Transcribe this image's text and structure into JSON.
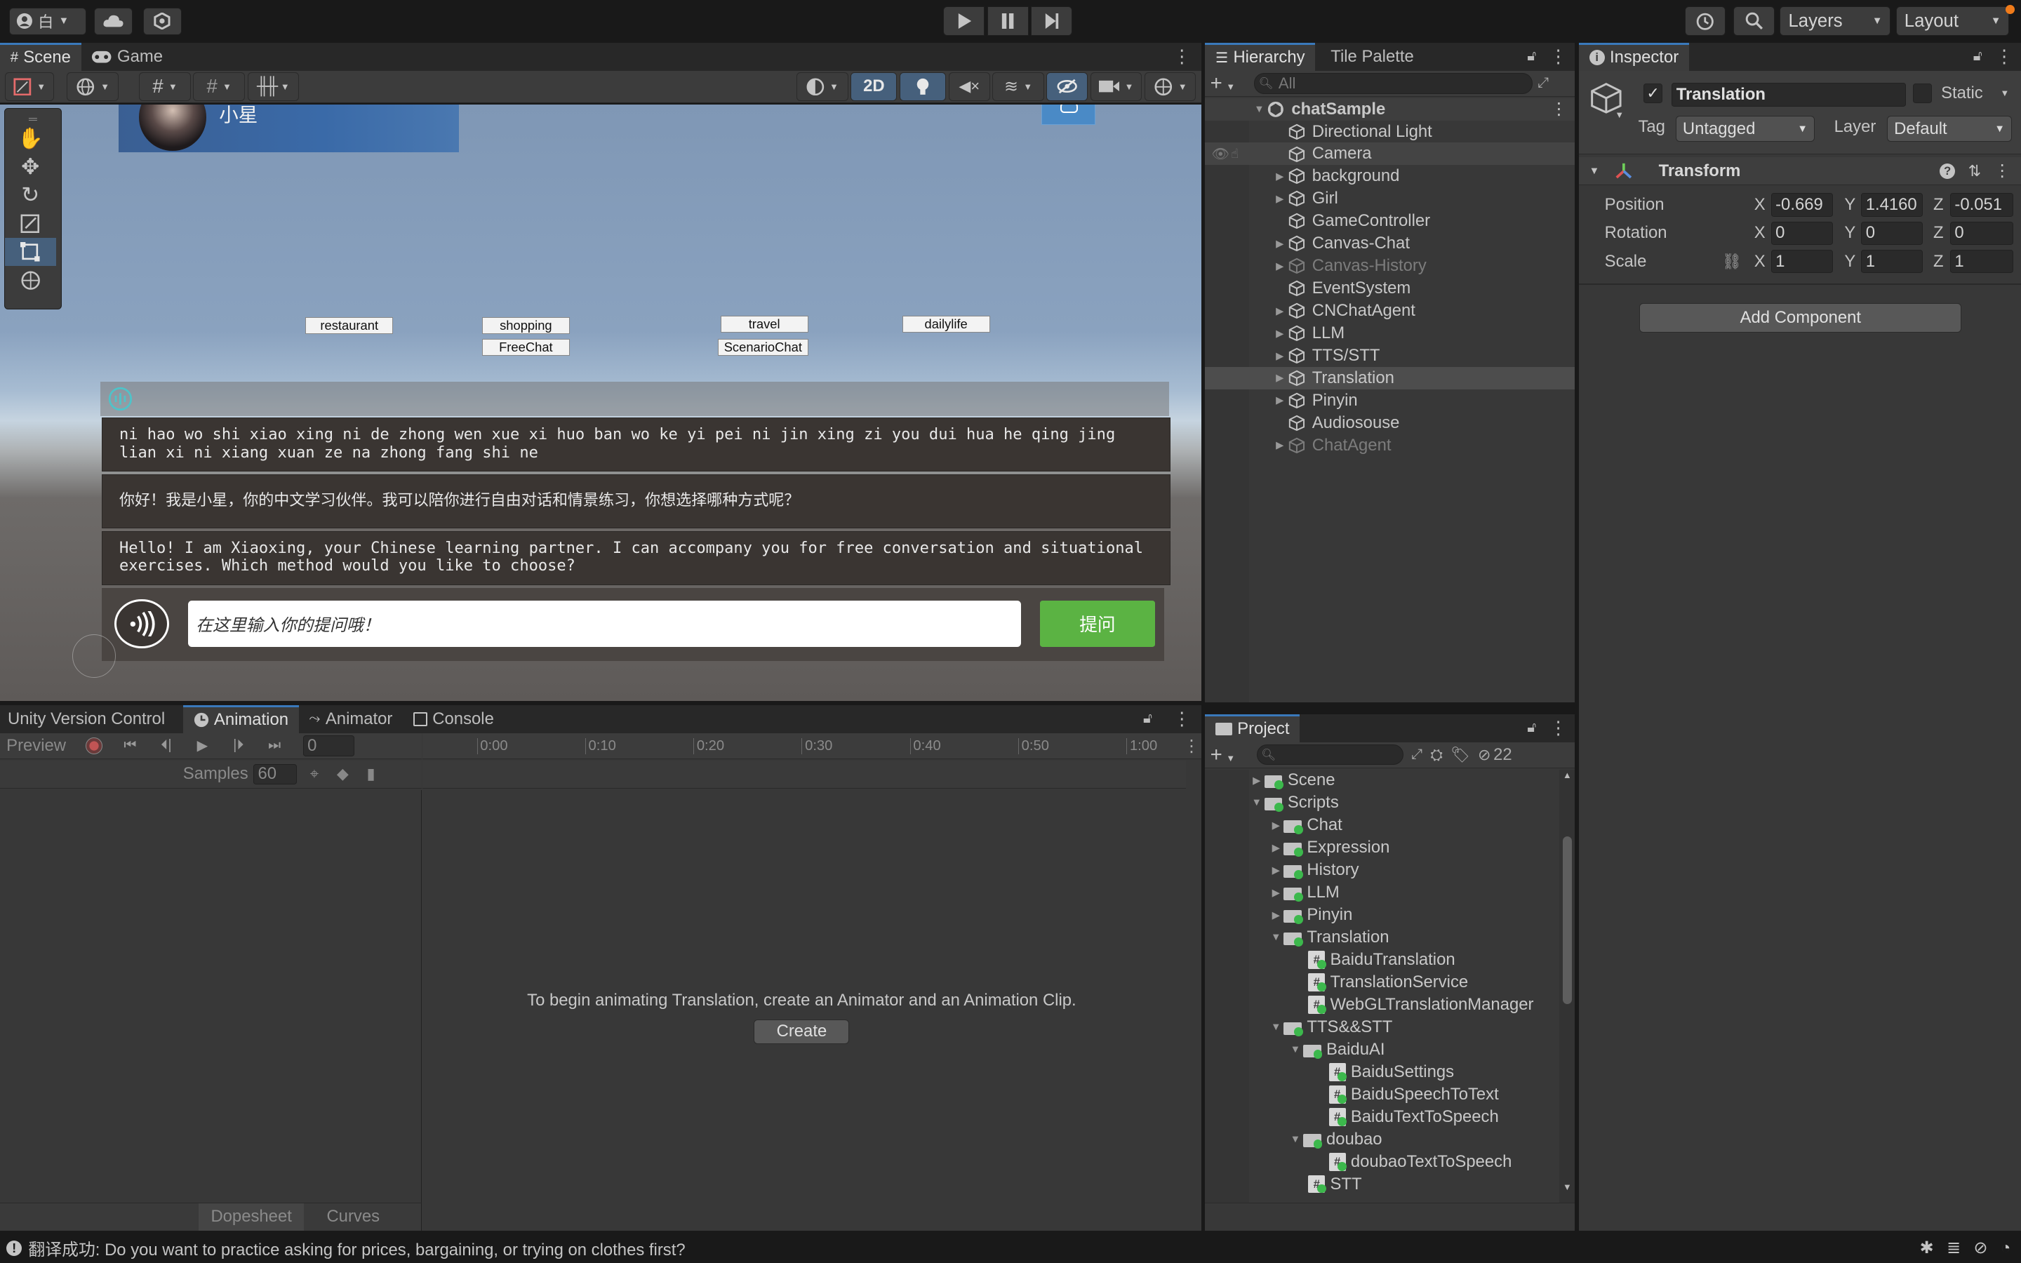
{
  "toolbar": {
    "account_label": "白",
    "layers_label": "Layers",
    "layout_label": "Layout"
  },
  "scene_tabs": {
    "scene": "Scene",
    "game": "Game"
  },
  "scene_toolbar": {
    "mode_2d": "2D"
  },
  "scene_view": {
    "character_name": "小星",
    "buttons": [
      "restaurant",
      "shopping",
      "travel",
      "dailylife",
      "FreeChat",
      "ScenarioChat"
    ],
    "pinyin_text": "ni hao wo shi xiao xing ni de zhong wen xue xi huo ban wo ke yi pei ni jin xing zi you dui hua he qing jing lian xi ni xiang xuan ze na zhong fang shi ne",
    "chinese_text": "你好！我是小星，你的中文学习伙伴。我可以陪你进行自由对话和情景练习，你想选择哪种方式呢？",
    "english_text": "Hello! I am Xiaoxing, your Chinese learning partner. I can accompany you for free conversation and situational exercises. Which method would you like to choose?",
    "input_placeholder": "在这里输入你的提问哦！",
    "ask_button": "提问"
  },
  "hierarchy": {
    "tab_label": "Hierarchy",
    "tile_palette_label": "Tile Palette",
    "search_placeholder": "All",
    "scene_name": "chatSample",
    "items": [
      {
        "label": "Directional Light"
      },
      {
        "label": "Camera"
      },
      {
        "label": "background"
      },
      {
        "label": "Girl"
      },
      {
        "label": "GameController"
      },
      {
        "label": "Canvas-Chat"
      },
      {
        "label": "Canvas-History"
      },
      {
        "label": "EventSystem"
      },
      {
        "label": "CNChatAgent"
      },
      {
        "label": "LLM"
      },
      {
        "label": "TTS/STT"
      },
      {
        "label": "Translation"
      },
      {
        "label": "Pinyin"
      },
      {
        "label": "Audiosouse"
      },
      {
        "label": "ChatAgent"
      }
    ]
  },
  "inspector": {
    "tab_label": "Inspector",
    "object_name": "Translation",
    "static_label": "Static",
    "tag_label": "Tag",
    "tag_value": "Untagged",
    "layer_label": "Layer",
    "layer_value": "Default",
    "component_title": "Transform",
    "position_label": "Position",
    "rotation_label": "Rotation",
    "scale_label": "Scale",
    "axis_x": "X",
    "axis_y": "Y",
    "axis_z": "Z",
    "position": {
      "x": "-0.669",
      "y": "1.4160",
      "z": "-0.051"
    },
    "rotation": {
      "x": "0",
      "y": "0",
      "z": "0"
    },
    "scale": {
      "x": "1",
      "y": "1",
      "z": "1"
    },
    "add_component": "Add Component"
  },
  "bottom_tabs": {
    "uvc": "Unity Version Control",
    "animation": "Animation",
    "animator": "Animator",
    "console": "Console"
  },
  "animation": {
    "preview_label": "Preview",
    "frame_value": "0",
    "samples_label": "Samples",
    "samples_value": "60",
    "timeline": [
      "0:00",
      "0:10",
      "0:20",
      "0:30",
      "0:40",
      "0:50",
      "1:00"
    ],
    "message": "To begin animating Translation, create an Animator and an Animation Clip.",
    "create_button": "Create",
    "dopesheet_tab": "Dopesheet",
    "curves_tab": "Curves"
  },
  "project": {
    "tab_label": "Project",
    "hidden_count": "22",
    "items": [
      {
        "label": "Scene"
      },
      {
        "label": "Scripts"
      },
      {
        "label": "Chat"
      },
      {
        "label": "Expression"
      },
      {
        "label": "History"
      },
      {
        "label": "LLM"
      },
      {
        "label": "Pinyin"
      },
      {
        "label": "Translation"
      },
      {
        "label": "BaiduTranslation"
      },
      {
        "label": "TranslationService"
      },
      {
        "label": "WebGLTranslationManager"
      },
      {
        "label": "TTS&&STT"
      },
      {
        "label": "BaiduAI"
      },
      {
        "label": "BaiduSettings"
      },
      {
        "label": "BaiduSpeechToText"
      },
      {
        "label": "BaiduTextToSpeech"
      },
      {
        "label": "doubao"
      },
      {
        "label": "doubaoTextToSpeech"
      },
      {
        "label": "STT"
      }
    ]
  },
  "status_bar": {
    "message": "翻译成功: Do you want to practice asking for prices, bargaining, or trying on clothes first?"
  }
}
